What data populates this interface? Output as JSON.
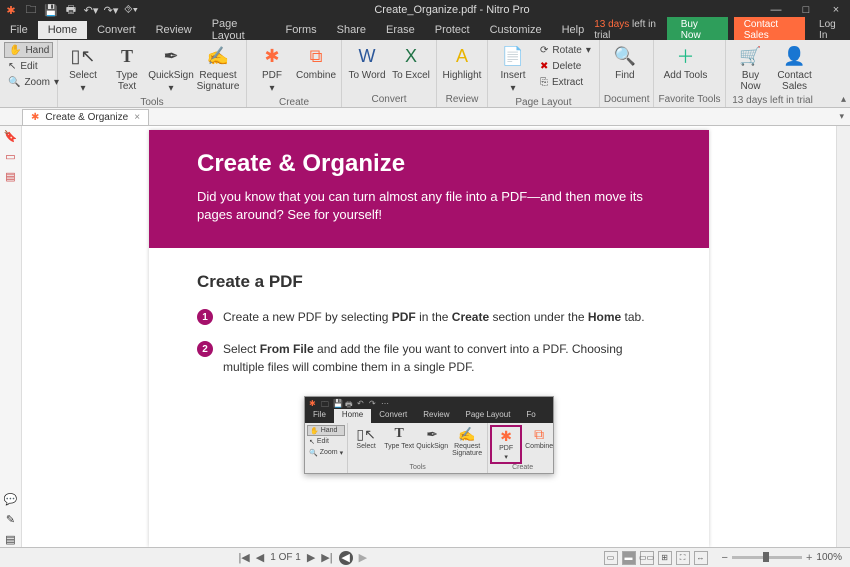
{
  "window": {
    "title": "Create_Organize.pdf - Nitro Pro",
    "minimize": "—",
    "maximize": "□",
    "close": "×"
  },
  "qat": [
    "folder",
    "save",
    "print",
    "undo",
    "redo",
    "more"
  ],
  "menu": {
    "items": [
      "File",
      "Home",
      "Convert",
      "Review",
      "Page Layout",
      "Forms",
      "Share",
      "Erase",
      "Protect",
      "Customize",
      "Help"
    ],
    "active": "Home",
    "trial_days": "13 days",
    "trial_suffix": " left in trial",
    "buy": "Buy Now",
    "contact": "Contact Sales",
    "login": "Log In"
  },
  "ribbon": {
    "view": {
      "hand": "Hand",
      "edit": "Edit",
      "zoom": "Zoom"
    },
    "tools": {
      "label": "Tools",
      "select": "Select",
      "type_text": "Type\nText",
      "quicksign": "QuickSign",
      "req_sig": "Request\nSignature"
    },
    "create": {
      "label": "Create",
      "pdf": "PDF",
      "combine": "Combine"
    },
    "convert": {
      "label": "Convert",
      "to_word": "To\nWord",
      "to_excel": "To\nExcel"
    },
    "review": {
      "label": "Review",
      "highlight": "Highlight"
    },
    "page_layout": {
      "label": "Page Layout",
      "insert": "Insert",
      "rotate": "Rotate",
      "delete": "Delete",
      "extract": "Extract"
    },
    "document": {
      "label": "Document",
      "find": "Find"
    },
    "fav": {
      "label": "Favorite Tools",
      "add": "Add\nTools"
    },
    "trial": {
      "label": "13 days left in trial",
      "buy": "Buy\nNow",
      "contact": "Contact\nSales"
    }
  },
  "doctab": {
    "name": "Create & Organize",
    "close": "×"
  },
  "doc": {
    "header_title": "Create & Organize",
    "header_sub": "Did you know that you can turn almost any file into a PDF—and then move its pages around? See for yourself!",
    "section_title": "Create a PDF",
    "step1_pre": "Create a new PDF by selecting ",
    "step1_b1": "PDF",
    "step1_mid": " in the ",
    "step1_b2": "Create",
    "step1_mid2": " section under the ",
    "step1_b3": "Home",
    "step1_end": " tab.",
    "step2_pre": "Select ",
    "step2_b1": "From File",
    "step2_end": " and add the file you want to convert into a PDF. Choosing multiple files will combine them in a single PDF."
  },
  "inner": {
    "tabs": [
      "File",
      "Home",
      "Convert",
      "Review",
      "Page Layout",
      "Fo"
    ],
    "hand": "Hand",
    "edit": "Edit",
    "zoom": "Zoom",
    "select": "Select",
    "type": "Type\nText",
    "quick": "QuickSign",
    "req": "Request\nSignature",
    "pdf": "PDF",
    "combine": "Combine",
    "tools_label": "Tools",
    "create_label": "Create"
  },
  "status": {
    "page_indicator": "1 OF 1",
    "zoom": "100%",
    "plus": "+"
  }
}
